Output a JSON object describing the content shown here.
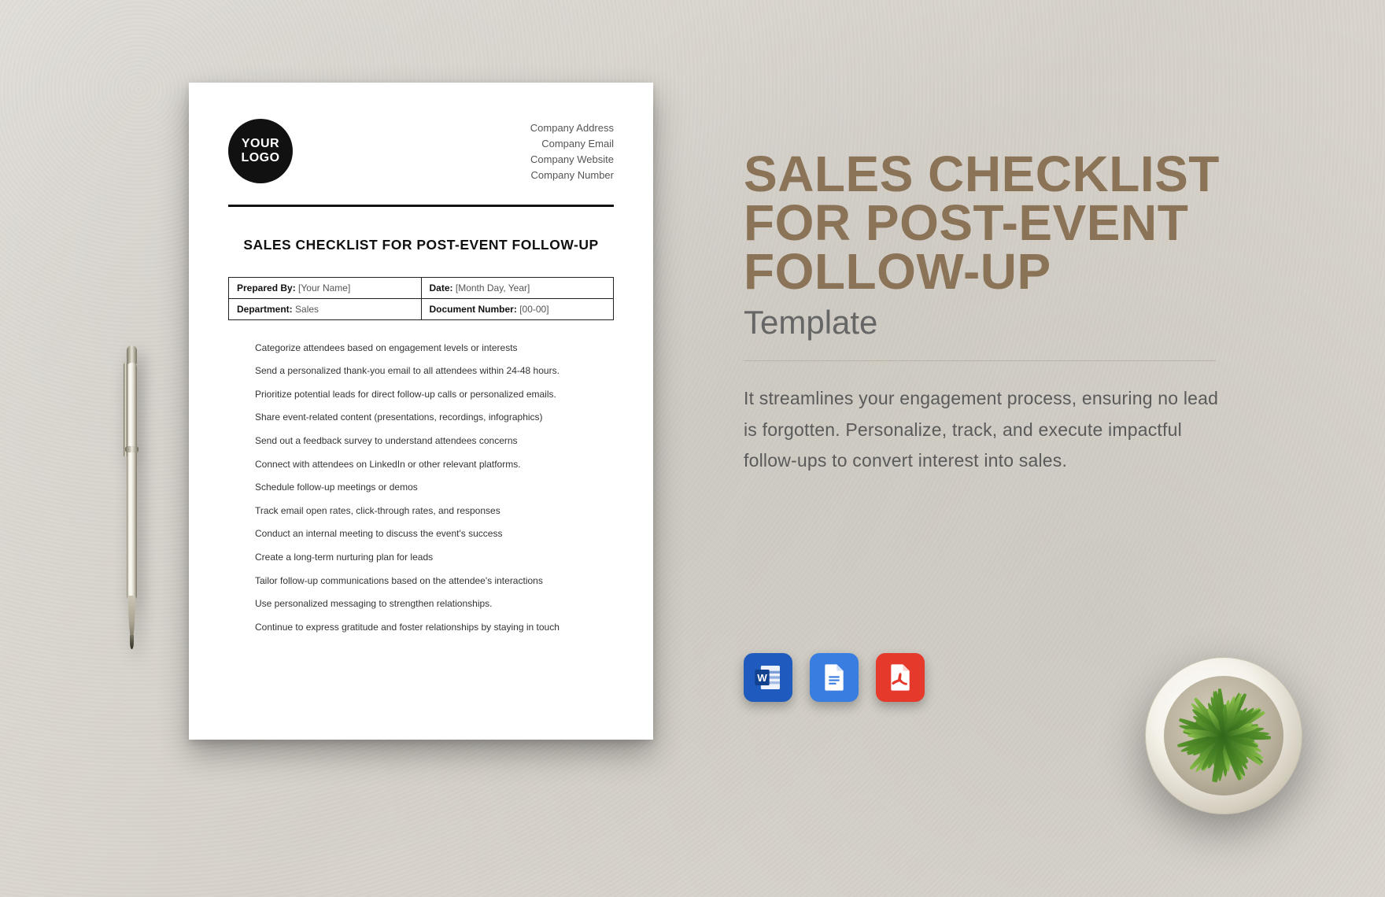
{
  "document": {
    "logo_line1": "YOUR",
    "logo_line2": "LOGO",
    "company_meta": [
      "Company Address",
      "Company Email",
      "Company Website",
      "Company Number"
    ],
    "title": "SALES CHECKLIST FOR POST-EVENT FOLLOW-UP",
    "meta": {
      "prepared_by_label": "Prepared By:",
      "prepared_by_value": "[Your Name]",
      "date_label": "Date:",
      "date_value": "[Month Day, Year]",
      "department_label": "Department:",
      "department_value": "Sales",
      "docnum_label": "Document Number:",
      "docnum_value": "[00-00]"
    },
    "items": [
      "Categorize attendees based on engagement levels or interests",
      "Send a personalized thank-you email to all attendees within 24-48 hours.",
      "Prioritize potential leads for direct follow-up calls or personalized emails.",
      "Share event-related content (presentations, recordings, infographics)",
      "Send out a feedback survey to understand attendees concerns",
      "Connect with attendees on LinkedIn or other relevant platforms.",
      "Schedule follow-up meetings or demos",
      "Track email open rates, click-through rates, and responses",
      "Conduct an internal meeting to discuss the event's success",
      "Create a long-term nurturing plan for leads",
      "Tailor follow-up communications based on the attendee's interactions",
      "Use personalized messaging to strengthen relationships.",
      "Continue to express gratitude and foster relationships by staying in touch"
    ]
  },
  "promo": {
    "headline": "SALES CHECKLIST FOR POST-EVENT FOLLOW-UP",
    "subhead": "Template",
    "description": "It streamlines your engagement process, ensuring no lead is forgotten. Personalize, track, and execute impactful follow-ups to convert interest into sales."
  },
  "formats": {
    "word": "Word",
    "gdoc": "Google Docs",
    "pdf": "PDF"
  }
}
